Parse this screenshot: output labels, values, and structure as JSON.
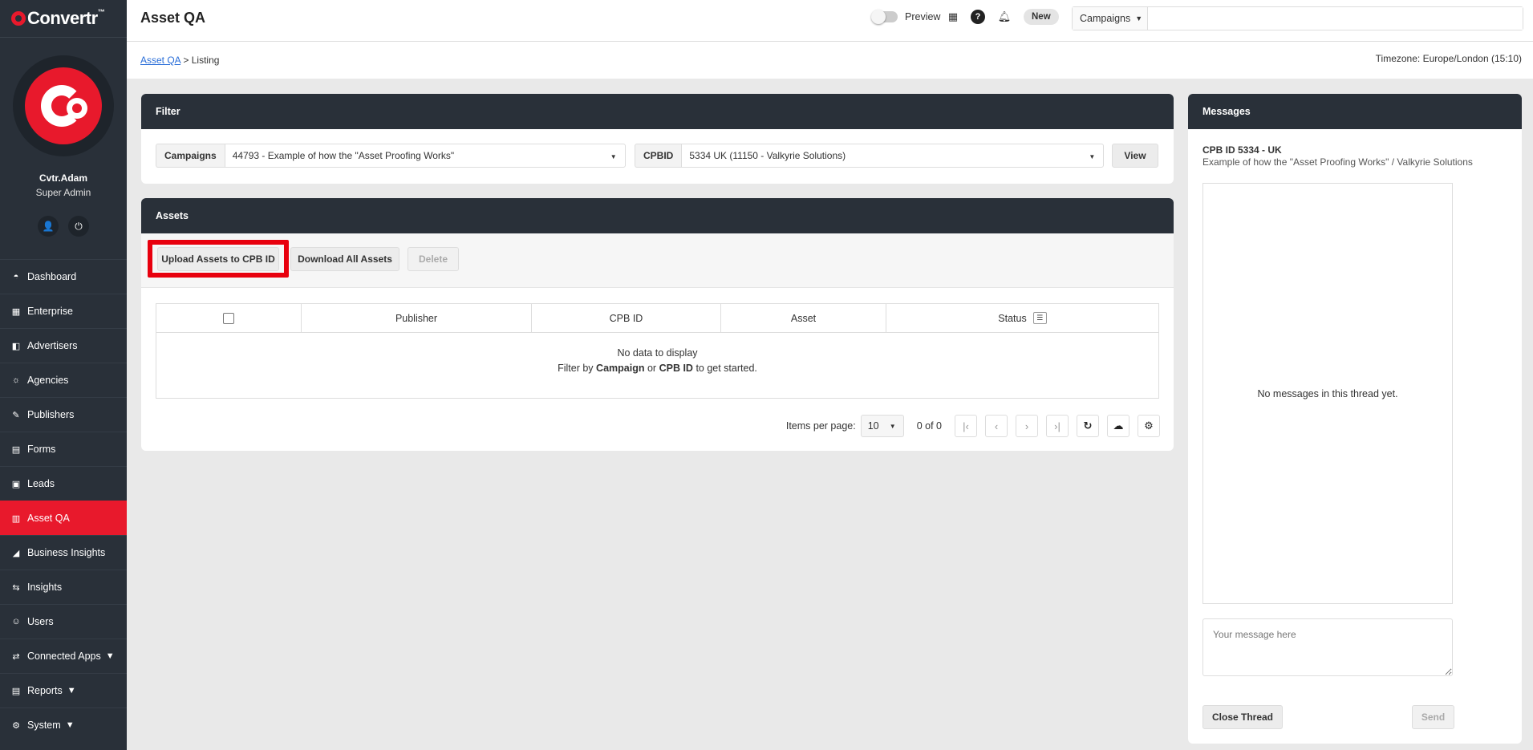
{
  "brand": {
    "name": "Convertr",
    "tm": "™",
    "accent": "#e8192c",
    "sidebar_bg": "#293039"
  },
  "user": {
    "name": "Cvtr.Adam",
    "role": "Super Admin"
  },
  "nav": [
    {
      "label": "Dashboard",
      "icon": "dashboard-icon"
    },
    {
      "label": "Enterprise",
      "icon": "building-icon"
    },
    {
      "label": "Advertisers",
      "icon": "advertisers-icon"
    },
    {
      "label": "Agencies",
      "icon": "agencies-icon"
    },
    {
      "label": "Publishers",
      "icon": "publishers-icon"
    },
    {
      "label": "Forms",
      "icon": "form-icon"
    },
    {
      "label": "Leads",
      "icon": "leads-icon"
    },
    {
      "label": "Asset QA",
      "icon": "asset-qa-icon",
      "active": true
    },
    {
      "label": "Business Insights",
      "icon": "chart-icon"
    },
    {
      "label": "Insights",
      "icon": "insights-icon"
    },
    {
      "label": "Users",
      "icon": "users-icon"
    },
    {
      "label": "Connected Apps",
      "icon": "connected-apps-icon",
      "has_children": true
    },
    {
      "label": "Reports",
      "icon": "reports-icon",
      "has_children": true
    },
    {
      "label": "System",
      "icon": "gear-icon",
      "has_children": true
    }
  ],
  "header": {
    "title": "Asset QA",
    "preview_label": "Preview",
    "new_badge": "New",
    "search_scope": "Campaigns",
    "search_value": ""
  },
  "breadcrumb": {
    "root": "Asset QA",
    "separator": ">",
    "current": "Listing"
  },
  "timezone": "Timezone: Europe/London (15:10)",
  "filter": {
    "title": "Filter",
    "campaigns_label": "Campaigns",
    "campaigns_value": "44793 - Example of how the \"Asset Proofing Works\"",
    "cpbid_label": "CPBID",
    "cpbid_value": "5334 UK (11150 - Valkyrie Solutions)",
    "view_button": "View"
  },
  "assets": {
    "title": "Assets",
    "upload_button": "Upload Assets to CPB ID",
    "download_button": "Download All Assets",
    "delete_button": "Delete",
    "columns": [
      "Publisher",
      "CPB ID",
      "Asset",
      "Status"
    ],
    "empty_line1": "No data to display",
    "empty_prefix": "Filter by",
    "empty_campaign": "Campaign",
    "empty_or": "or",
    "empty_cpbid": "CPB ID",
    "empty_suffix": "to get started.",
    "pager": {
      "items_per_page_label": "Items per page:",
      "items_per_page": "10",
      "range": "0 of 0"
    }
  },
  "messages": {
    "title": "Messages",
    "thread_title": "CPB ID  5334  - UK",
    "thread_subtitle": "Example of how the \"Asset Proofing Works\" / Valkyrie Solutions",
    "empty": "No messages in this thread yet.",
    "input_placeholder": "Your message here",
    "close_button": "Close Thread",
    "send_button": "Send"
  }
}
